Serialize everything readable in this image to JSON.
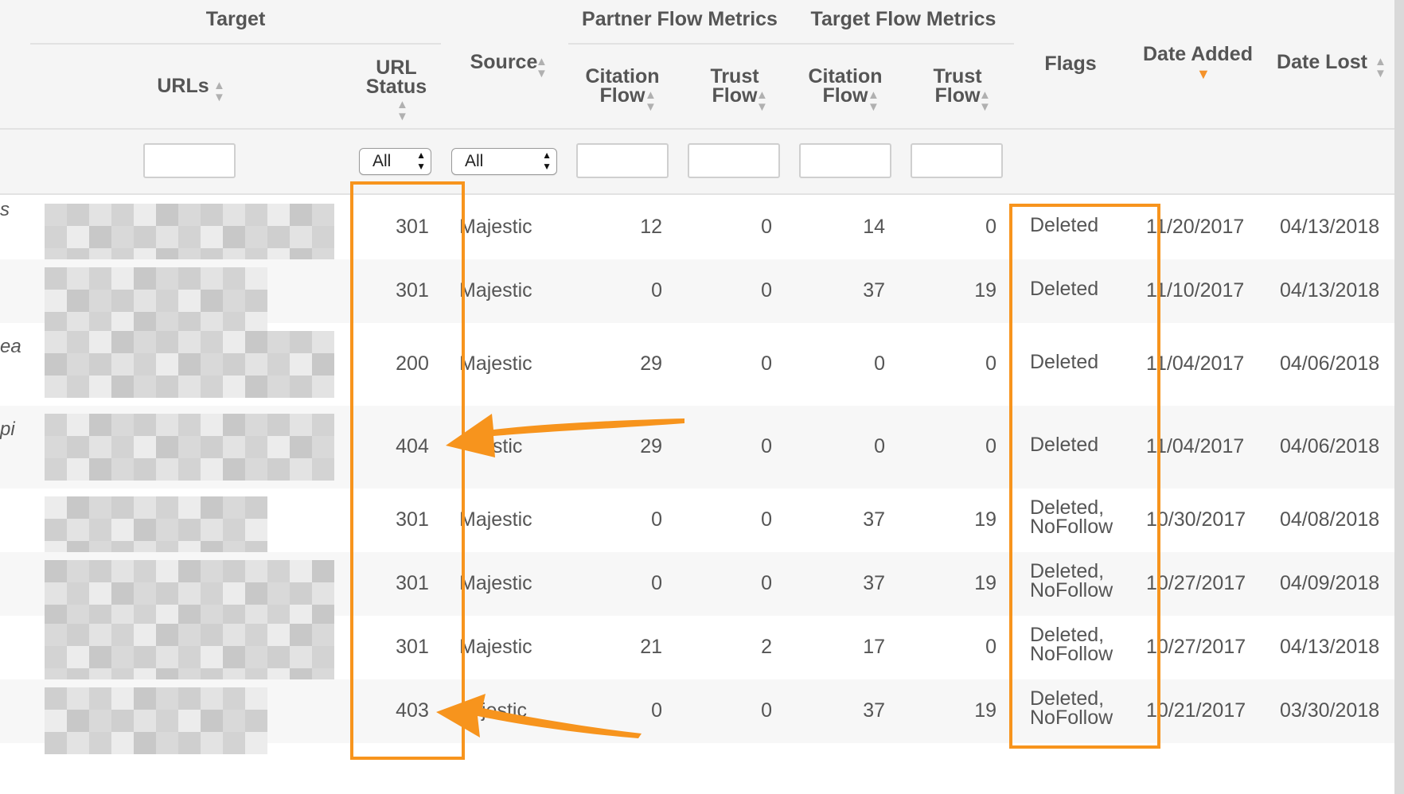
{
  "header": {
    "group_target": "Target",
    "group_partner": "Partner Flow Metrics",
    "group_target_flow": "Target Flow Metrics",
    "col_urls": "URLs",
    "col_url_status_1": "URL",
    "col_url_status_2": "Status",
    "col_source": "Source",
    "col_partner_cf_1": "Citation",
    "col_partner_cf_2": "Flow",
    "col_partner_tf_1": "Trust",
    "col_partner_tf_2": "Flow",
    "col_target_cf_1": "Citation",
    "col_target_cf_2": "Flow",
    "col_target_tf_1": "Trust",
    "col_target_tf_2": "Flow",
    "col_flags": "Flags",
    "col_date_added": "Date Added",
    "col_date_lost": "Date Lost"
  },
  "filters": {
    "url_status": "All",
    "source": "All"
  },
  "rows": [
    {
      "cut": "s",
      "status": "301",
      "source": "Majestic",
      "pcf": "12",
      "ptf": "0",
      "tcf": "14",
      "ttf": "0",
      "flags1": "Deleted",
      "flags2": "",
      "added": "11/20/2017",
      "lost": "04/13/2018"
    },
    {
      "cut": "",
      "status": "301",
      "source": "Majestic",
      "pcf": "0",
      "ptf": "0",
      "tcf": "37",
      "ttf": "19",
      "flags1": "Deleted",
      "flags2": "",
      "added": "11/10/2017",
      "lost": "04/13/2018"
    },
    {
      "cut": "ea",
      "status": "200",
      "source": "Majestic",
      "pcf": "29",
      "ptf": "0",
      "tcf": "0",
      "ttf": "0",
      "flags1": "Deleted",
      "flags2": "",
      "added": "11/04/2017",
      "lost": "04/06/2018"
    },
    {
      "cut": "pi",
      "status": "404",
      "source": "estic",
      "pcf": "29",
      "ptf": "0",
      "tcf": "0",
      "ttf": "0",
      "flags1": "Deleted",
      "flags2": "",
      "added": "11/04/2017",
      "lost": "04/06/2018"
    },
    {
      "cut": "",
      "status": "301",
      "source": "Majestic",
      "pcf": "0",
      "ptf": "0",
      "tcf": "37",
      "ttf": "19",
      "flags1": "Deleted,",
      "flags2": "NoFollow",
      "added": "10/30/2017",
      "lost": "04/08/2018"
    },
    {
      "cut": "",
      "status": "301",
      "source": "Majestic",
      "pcf": "0",
      "ptf": "0",
      "tcf": "37",
      "ttf": "19",
      "flags1": "Deleted,",
      "flags2": "NoFollow",
      "added": "10/27/2017",
      "lost": "04/09/2018"
    },
    {
      "cut": "",
      "status": "301",
      "source": "Majestic",
      "pcf": "21",
      "ptf": "2",
      "tcf": "17",
      "ttf": "0",
      "flags1": "Deleted,",
      "flags2": "NoFollow",
      "added": "10/27/2017",
      "lost": "04/13/2018"
    },
    {
      "cut": "",
      "status": "403",
      "source": "jestic",
      "pcf": "0",
      "ptf": "0",
      "tcf": "37",
      "ttf": "19",
      "flags1": "Deleted,",
      "flags2": "NoFollow",
      "added": "10/21/2017",
      "lost": "03/30/2018"
    }
  ],
  "colors": {
    "annotation": "#f7941d",
    "sort_active": "#f4922a",
    "header_bg": "#f5f5f5",
    "text": "#555555"
  }
}
